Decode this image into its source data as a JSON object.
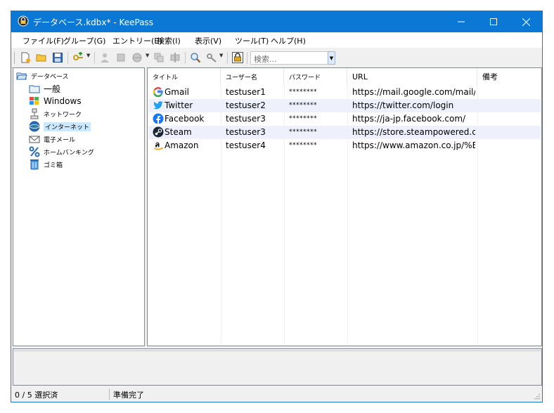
{
  "window": {
    "title": "データベース.kdbx* - KeePass"
  },
  "menu": [
    {
      "label": "ファイル(F)"
    },
    {
      "label": "グループ(G)"
    },
    {
      "label": "エントリー(E)"
    },
    {
      "label": "検索(I)"
    },
    {
      "label": "表示(V)"
    },
    {
      "label": "ツール(T)"
    },
    {
      "label": "ヘルプ(H)"
    }
  ],
  "toolbar": {
    "search_placeholder": "検索..."
  },
  "tree": {
    "root": "データベース",
    "groups": [
      {
        "label": "一般",
        "icon": "folder-icon"
      },
      {
        "label": "Windows",
        "icon": "windows-icon"
      },
      {
        "label": "ネットワーク",
        "icon": "network-icon"
      },
      {
        "label": "インターネット",
        "icon": "internet-icon",
        "selected": true
      },
      {
        "label": "電子メール",
        "icon": "email-icon"
      },
      {
        "label": "ホームバンキング",
        "icon": "percent-icon"
      },
      {
        "label": "ゴミ箱",
        "icon": "recycle-bin-icon"
      }
    ]
  },
  "list": {
    "columns": [
      "タイトル",
      "ユーザー名",
      "パスワード",
      "URL",
      "備考"
    ],
    "rows": [
      {
        "title": "Gmail",
        "user": "testuser1",
        "password": "********",
        "url": "https://mail.google.com/mail/",
        "notes": "",
        "icon": "google-icon"
      },
      {
        "title": "Twitter",
        "user": "testuser2",
        "password": "********",
        "url": "https://twitter.com/login",
        "notes": "",
        "icon": "twitter-icon"
      },
      {
        "title": "Facebook",
        "user": "testuser3",
        "password": "********",
        "url": "https://ja-jp.facebook.com/",
        "notes": "",
        "icon": "facebook-icon"
      },
      {
        "title": "Steam",
        "user": "testuser3",
        "password": "********",
        "url": "https://store.steampowered.co...",
        "notes": "",
        "icon": "steam-icon"
      },
      {
        "title": "Amazon",
        "user": "testuser4",
        "password": "********",
        "url": "https://www.amazon.co.jp/%E...",
        "notes": "",
        "icon": "amazon-icon"
      }
    ]
  },
  "status": {
    "selection": "0 / 5 選択済",
    "state": "準備完了"
  },
  "colors": {
    "titlebar": "#0a78d4",
    "row_alt": "#eef0fb",
    "selection": "#cce8ff"
  }
}
